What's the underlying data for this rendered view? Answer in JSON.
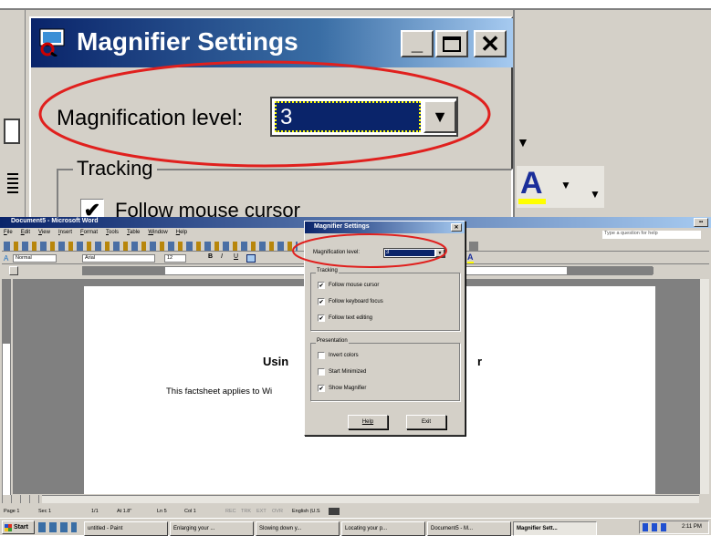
{
  "colors": {
    "face": "#d4d0c8",
    "title_dark": "#0a246a",
    "title_light": "#a6caf0",
    "highlight": "#ff0000",
    "select": "#0a246a"
  },
  "zoomed": {
    "title": "Magnifier Settings",
    "level_label": "Magnification level:",
    "level_value": "3",
    "tracking_label": "Tracking",
    "follow_mouse": "Follow mouse cursor",
    "font_color_glyph": "A"
  },
  "word": {
    "title": "Document5 - Microsoft Word",
    "menu": [
      "File",
      "Edit",
      "View",
      "Insert",
      "Format",
      "Tools",
      "Table",
      "Window",
      "Help"
    ],
    "help_box": "Type a question for help",
    "style": "Normal",
    "font": "Arial",
    "size": "12",
    "doc_heading_left": "Usin",
    "doc_heading_right": "r",
    "doc_text": "This factsheet applies to Wi",
    "status": [
      "Page 1",
      "Sec 1",
      "1/1",
      "At 1.8\"",
      "Ln 5",
      "Col 1",
      "REC",
      "TRK",
      "EXT",
      "OVR",
      "English (U.S"
    ]
  },
  "magnifier": {
    "title": "Magnifier Settings",
    "level_label": "Magnification level:",
    "level_value": "3",
    "tracking_label": "Tracking",
    "tracking": [
      {
        "label": "Follow mouse cursor",
        "checked": true
      },
      {
        "label": "Follow keyboard focus",
        "checked": true
      },
      {
        "label": "Follow text editing",
        "checked": true
      }
    ],
    "presentation_label": "Presentation",
    "presentation": [
      {
        "label": "Invert colors",
        "checked": false
      },
      {
        "label": "Start Minimized",
        "checked": false
      },
      {
        "label": "Show Magnifier",
        "checked": true
      }
    ],
    "help_btn": "Help",
    "exit_btn": "Exit"
  },
  "taskbar": {
    "start": "Start",
    "items": [
      "untitled - Paint",
      "Enlarging your ...",
      "Slowing down y...",
      "Locating your p...",
      "Document5 - M...",
      "Magnifier Sett..."
    ],
    "clock": "2:11 PM"
  }
}
